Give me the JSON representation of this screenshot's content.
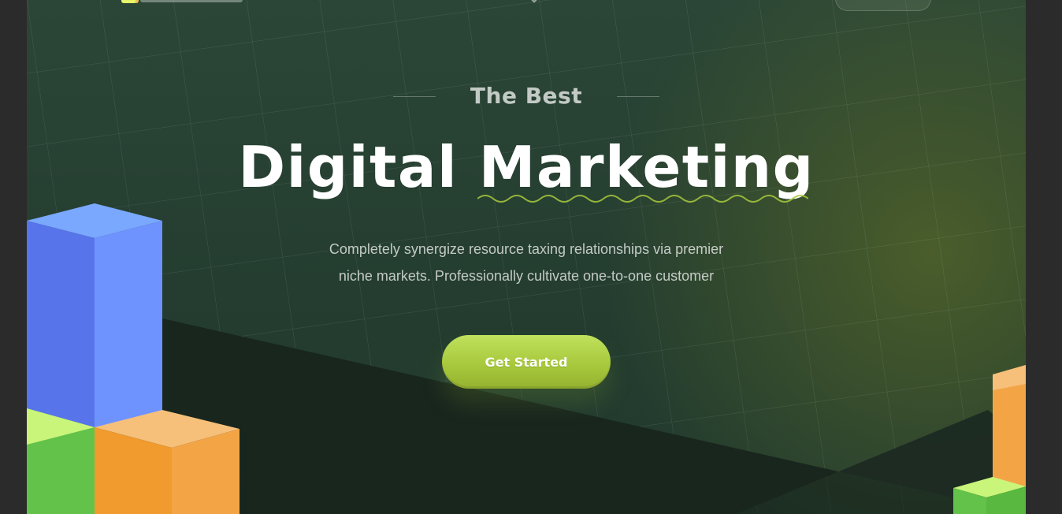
{
  "hero": {
    "eyebrow": "The Best",
    "headline_part1": "Digital",
    "headline_part2": "Marketing",
    "description_line1": "Completely synergize resource taxing relationships via premier",
    "description_line2": "niche markets. Professionally cultivate one-to-one customer",
    "cta_label": "Get Started"
  },
  "colors": {
    "background": "#243d30",
    "cta": "#a8c93d",
    "cube_blue": "#5b7cf1",
    "cube_green": "#6acc4a",
    "cube_orange": "#f4a034"
  },
  "icons": {
    "logo": "logo-mark",
    "nav": "chevron-down-icon"
  }
}
